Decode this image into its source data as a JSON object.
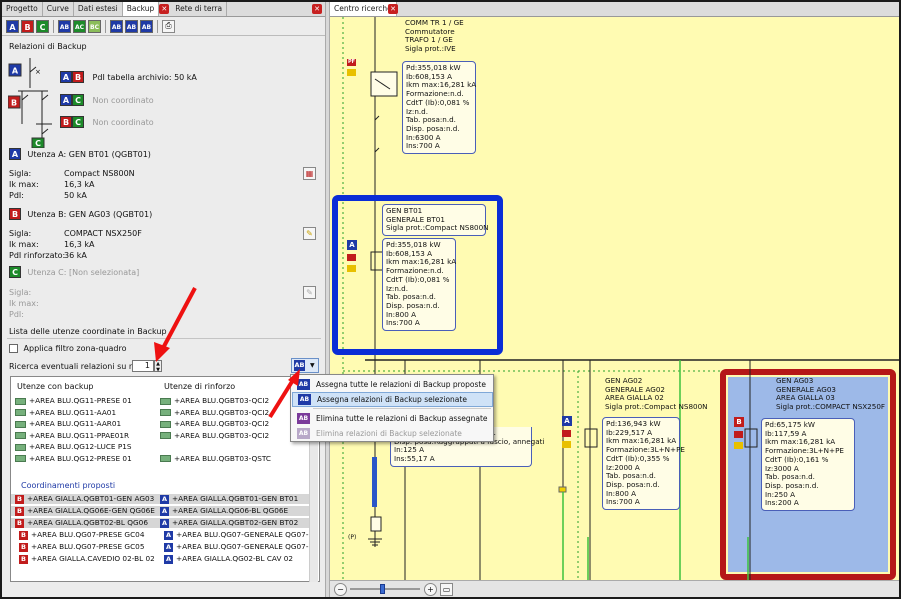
{
  "left_tabs": [
    {
      "label": "Progetto"
    },
    {
      "label": "Curve"
    },
    {
      "label": "Dati estesi"
    },
    {
      "label": "Backup"
    },
    {
      "label": "Rete di terra"
    }
  ],
  "right_tabs": [
    {
      "label": "Centro ricerche"
    }
  ],
  "toolbar": {
    "b1": "A",
    "b2": "B",
    "b3": "C",
    "b4": "AB",
    "b5": "AC",
    "b6": "BC",
    "b7": "AB",
    "b8": "AB",
    "b9": "AB"
  },
  "panel": {
    "title": "Relazioni di Backup",
    "ab_text": "PdI tabella archivio: 50 kA",
    "ac_text": "Non coordinato",
    "bc_text": "Non coordinato",
    "utenza_a": "Utenza A: GEN BT01 (QGBT01)",
    "a_sigla_label": "Sigla:",
    "a_sigla_value": "Compact NS800N",
    "a_ik_label": "Ik max:",
    "a_ik_value": "16,3 kA",
    "a_pdi_label": "PdI:",
    "a_pdi_value": "50 kA",
    "utenza_b": "Utenza B: GEN AG03 (QGBT01)",
    "b_sigla_label": "Sigla:",
    "b_sigla_value": "COMPACT NSX250F",
    "b_ik_label": "Ik max:",
    "b_ik_value": "16,3 kA",
    "b_pdi_label": "PdI rinforzato:",
    "b_pdi_value": "36 kA",
    "utenza_c": "Utenza C: [Non selezionata]",
    "c_sigla_label": "Sigla:",
    "c_ik_label": "Ik max:",
    "c_pdi_label": "PdI:",
    "lista_title": "Lista delle utenze coordinate in Backup",
    "filtro_label": "Applica filtro zona-quadro",
    "ricerca_label": "Ricerca eventuali relazioni su n livelli",
    "ricerca_value": "1",
    "col1": "Utenze con backup",
    "col2": "Utenze di rinforzo",
    "proposti_title": "Coordinamenti proposti"
  },
  "list_rows": [
    {
      "a": "+AREA BLU.QG11-PRESE 01",
      "b": "+AREA BLU.QGBT03-QCI2"
    },
    {
      "a": "+AREA BLU.QG11-AA01",
      "b": "+AREA BLU.QGBT03-QCI2"
    },
    {
      "a": "+AREA BLU.QG11-AAR01",
      "b": "+AREA BLU.QGBT03-QCI2"
    },
    {
      "a": "+AREA BLU.QG11-PPAE01R",
      "b": "+AREA BLU.QGBT03-QCI2"
    },
    {
      "a": "+AREA BLU.QG12-LUCE P1S",
      "b": ""
    },
    {
      "a": "+AREA BLU.QG12-PRESE 01",
      "b": "+AREA BLU.QGBT03-QSTC"
    }
  ],
  "proposed_rows": [
    {
      "a": "+AREA GIALLA.QGBT01-GEN AG03",
      "b": "+AREA GIALLA.QGBT01-GEN BT01"
    },
    {
      "a": "+AREA GIALLA.QG06E-GEN QG06E",
      "b": "+AREA GIALLA.QG06-BL QG06E"
    },
    {
      "a": "+AREA GIALLA.QGBT02-BL QG06",
      "b": "+AREA GIALLA.QGBT02-GEN BT02"
    },
    {
      "a": "+AREA BLU.QG07-PRESE GC04",
      "b": "+AREA BLU.QG07-GENERALE QG07-1"
    },
    {
      "a": "+AREA BLU.QG07-PRESE GC05",
      "b": "+AREA BLU.QG07-GENERALE QG07-1"
    },
    {
      "a": "+AREA GIALLA.CAVEDIO 02-BL 02",
      "b": "+AREA GIALLA.QG02-BL CAV 02"
    }
  ],
  "menu": {
    "m1": "Assegna tutte le relazioni di Backup proposte",
    "m2": "Assegna relazioni di Backup selezionate",
    "m3": "Elimina tutte le relazioni di Backup assegnate",
    "m4": "Elimina relazioni di Backup selezionate"
  },
  "diagram": {
    "box_top_title": [
      "COMM TR 1 / GE",
      "Commutatore",
      "TRAFO 1 / GE",
      "Sigla prot.:IVE"
    ],
    "box_top_data": [
      "Pd:355,018 kW",
      "Ib:608,153 A",
      "Ikm max:16,281 kA",
      "Formazione:n.d.",
      "CdtT (Ib):0,081 %",
      "Iz:n.d.",
      "Tab. posa:n.d.",
      "Disp. posa:n.d.",
      "In:6300 A",
      "Ins:700 A"
    ],
    "box_bt01_title": [
      "GEN BT01",
      "GENERALE BT01",
      "Sigla prot.:Compact NS800N"
    ],
    "box_bt01_data": [
      "Pd:355,018 kW",
      "Ib:608,153 A",
      "Ikm max:16,281 kA",
      "Formazione:n.d.",
      "CdtT (Ib):0,081 %",
      "Iz:n.d.",
      "Tab. posa:n.d.",
      "Disp. posa:n.d.",
      "In:800 A",
      "Ins:700 A"
    ],
    "box_left_partial": [
      "Tab. posa:CEI-UNEL 35024/1",
      "Disp. posa:Raggruppati a fascio, annegati",
      "In:125 A",
      "Ins:55,17 A"
    ],
    "box_ag02_title": [
      "GEN AG02",
      "GENERALE AG02",
      "AREA GIALLA 02",
      "Sigla prot.:Compact NS800N"
    ],
    "box_ag02_data": [
      "Pd:136,943 kW",
      "Ib:229,517 A",
      "Ikm max:16,281 kA",
      "Formazione:3L+N+PE",
      "CdtT (Ib):0,355 %",
      "Iz:2000 A",
      "Tab. posa:n.d.",
      "Disp. posa:n.d.",
      "In:800 A",
      "Ins:700 A"
    ],
    "box_ag03_title": [
      "GEN AG03",
      "GENERALE AG03",
      "AREA GIALLA 03",
      "Sigla prot.:COMPACT NSX250F"
    ],
    "box_ag03_data": [
      "Pd:65,175 kW",
      "Ib:117,59 A",
      "Ikm max:16,281 kA",
      "Formazione:3L+N+PE",
      "CdtT (Ib):0,161 %",
      "Iz:3000 A",
      "Tab. posa:n.d.",
      "Disp. posa:n.d.",
      "In:250 A",
      "Ins:200 A"
    ],
    "p_label": "(P)"
  },
  "colors": {
    "accent_blue": "#1f3aa6",
    "accent_red": "#c11c1c",
    "accent_green": "#1d8a2a",
    "canvas": "#fffbb2",
    "highlight_blue": "#0a2dd6",
    "highlight_red": "#b51818"
  }
}
